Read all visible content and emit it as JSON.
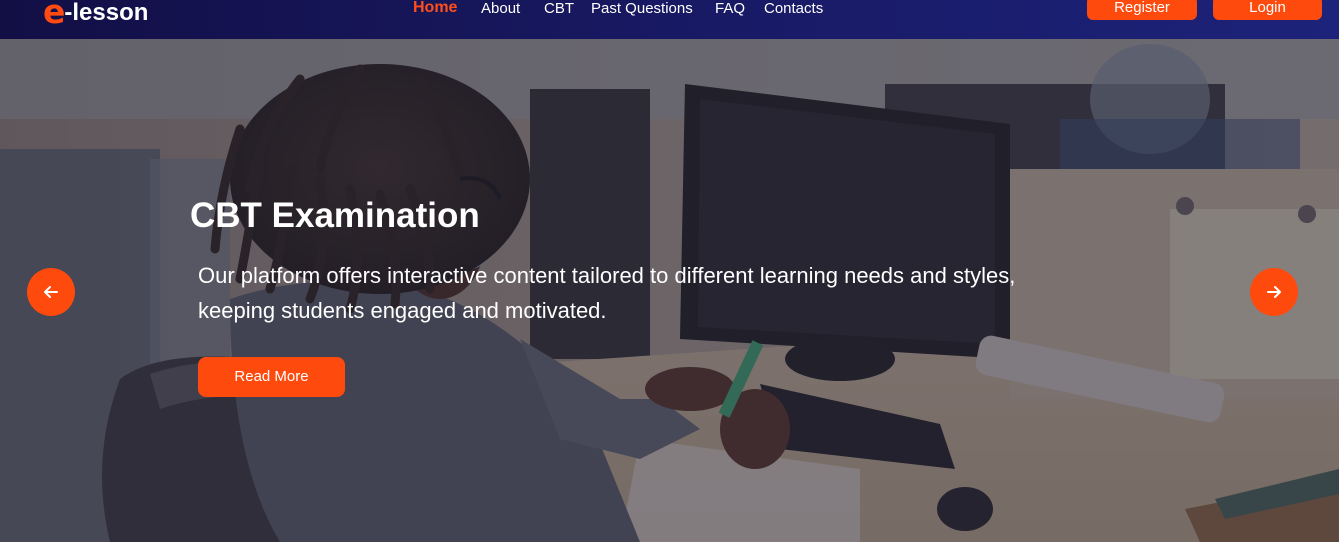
{
  "brand": {
    "logo_letter": "e",
    "logo_text": "-lesson"
  },
  "nav": {
    "items": [
      {
        "label": "Home",
        "active": true
      },
      {
        "label": "About",
        "active": false
      },
      {
        "label": "CBT",
        "active": false
      },
      {
        "label": "Past Questions",
        "active": false
      },
      {
        "label": "FAQ",
        "active": false
      },
      {
        "label": "Contacts",
        "active": false
      }
    ],
    "register_label": "Register",
    "login_label": "Login"
  },
  "hero": {
    "title": "CBT Examination",
    "description": "Our platform offers interactive content tailored to different learning needs and styles, keeping students engaged and motivated.",
    "cta_label": "Read More",
    "prev_icon": "arrow-left-icon",
    "next_icon": "arrow-right-icon",
    "background_image": "student-at-computer-photo"
  },
  "colors": {
    "accent": "#ff4a0e",
    "nav_bg": "#181a63",
    "text_light": "#ffffff"
  }
}
